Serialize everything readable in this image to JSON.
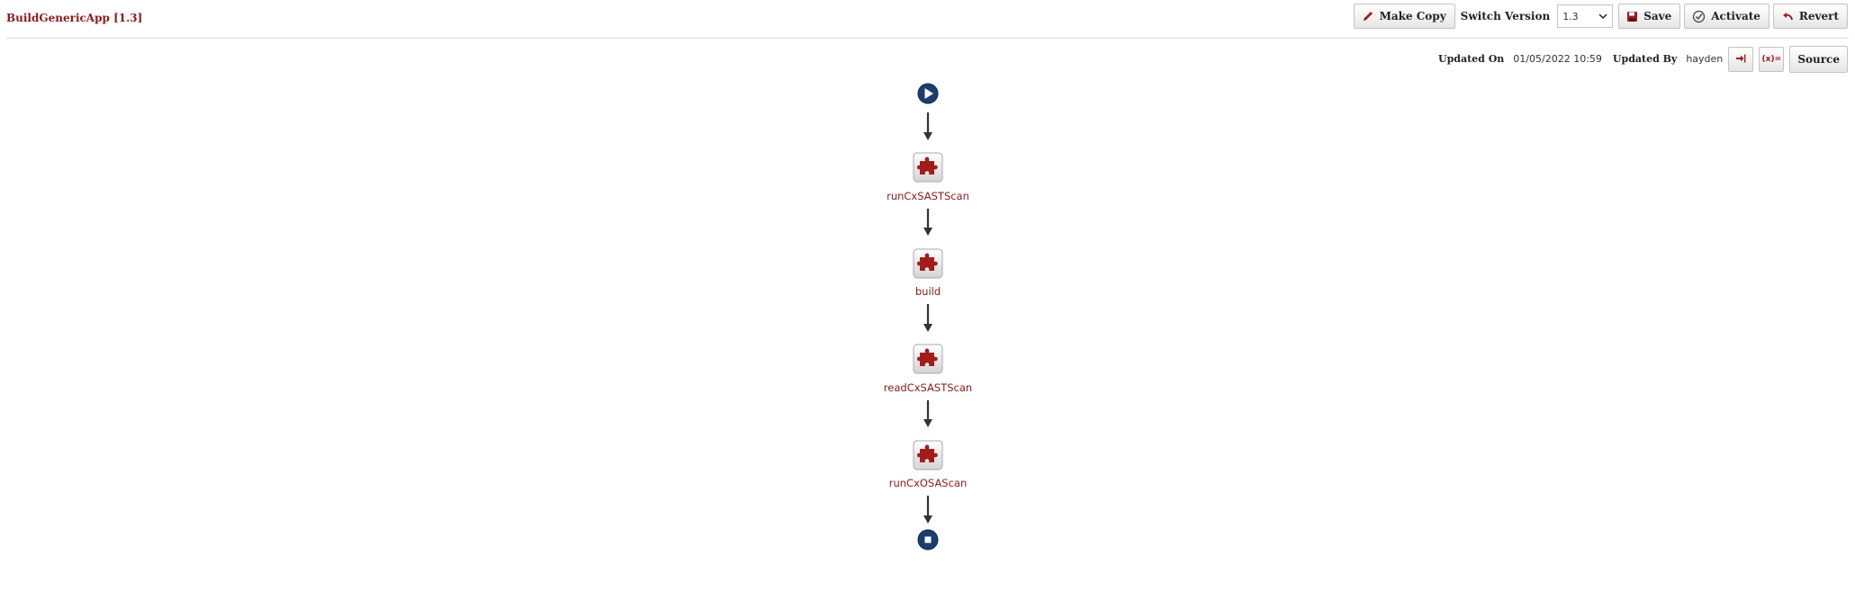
{
  "app": {
    "title": "BuildGenericApp [1.3]"
  },
  "toolbar": {
    "make_copy_label": "Make Copy",
    "switch_version_label": "Switch Version",
    "version_selected": "1.3",
    "save_label": "Save",
    "activate_label": "Activate",
    "revert_label": "Revert"
  },
  "meta": {
    "updated_on_label": "Updated On",
    "updated_on_value": "01/05/2022 10:59",
    "updated_by_label": "Updated By",
    "updated_by_value": "hayden"
  },
  "subtools": {
    "variables_label": "(x)=",
    "source_label": "Source"
  },
  "flow": {
    "steps": [
      {
        "label": "runCxSASTScan"
      },
      {
        "label": "build"
      },
      {
        "label": "readCxSASTScan"
      },
      {
        "label": "runCxOSAScan"
      }
    ]
  },
  "colors": {
    "accent": "#8b1a1a",
    "node_blue": "#1b3d6e",
    "puzzle_red": "#a31c1c"
  }
}
